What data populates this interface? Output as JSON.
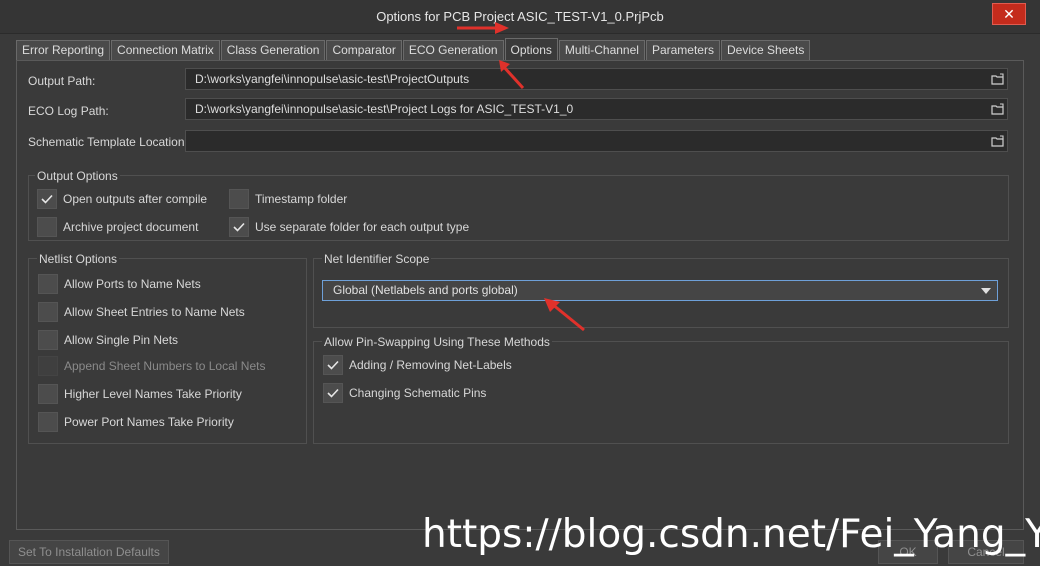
{
  "window": {
    "title": "Options for PCB Project ASIC_TEST-V1_0.PrjPcb",
    "close_glyph": "✕"
  },
  "tabs": [
    {
      "label": "Error Reporting"
    },
    {
      "label": "Connection Matrix"
    },
    {
      "label": "Class Generation"
    },
    {
      "label": "Comparator"
    },
    {
      "label": "ECO Generation"
    },
    {
      "label": "Options",
      "active": true
    },
    {
      "label": "Multi-Channel"
    },
    {
      "label": "Parameters"
    },
    {
      "label": "Device Sheets"
    }
  ],
  "paths": {
    "output_path": {
      "label": "Output Path:",
      "value": "D:\\works\\yangfei\\innopulse\\asic-test\\ProjectOutputs"
    },
    "eco_log_path": {
      "label": "ECO Log Path:",
      "value": "D:\\works\\yangfei\\innopulse\\asic-test\\Project Logs for ASIC_TEST-V1_0"
    },
    "schematic_template": {
      "label": "Schematic Template Location:",
      "value": ""
    }
  },
  "output_options": {
    "title": "Output Options",
    "items": [
      {
        "label": "Open outputs after compile",
        "checked": true
      },
      {
        "label": "Timestamp folder",
        "checked": false
      },
      {
        "label": "Archive project document",
        "checked": false
      },
      {
        "label": "Use separate folder for each output type",
        "checked": true
      }
    ]
  },
  "netlist_options": {
    "title": "Netlist Options",
    "items": [
      {
        "label": "Allow Ports to Name Nets",
        "checked": false
      },
      {
        "label": "Allow Sheet Entries to Name Nets",
        "checked": false
      },
      {
        "label": "Allow Single Pin Nets",
        "checked": false
      },
      {
        "label": "Append Sheet Numbers to Local Nets",
        "checked": false,
        "disabled": true
      },
      {
        "label": "Higher Level Names Take Priority",
        "checked": false
      },
      {
        "label": "Power Port Names Take Priority",
        "checked": false
      }
    ]
  },
  "net_identifier_scope": {
    "title": "Net Identifier Scope",
    "selected": "Global (Netlabels and ports global)"
  },
  "pin_swapping": {
    "title": "Allow Pin-Swapping Using These Methods",
    "items": [
      {
        "label": "Adding / Removing Net-Labels",
        "checked": true
      },
      {
        "label": "Changing Schematic Pins",
        "checked": true
      }
    ]
  },
  "footer": {
    "defaults_button": "Set To Installation Defaults",
    "ok_button": "OK",
    "cancel_button": "Cancel"
  },
  "watermark": "https://blog.csdn.net/Fei_Yang_YF",
  "colors": {
    "accent": "#6ea0d8",
    "close": "#c42b1c",
    "annotation_arrow": "#e0312b"
  }
}
